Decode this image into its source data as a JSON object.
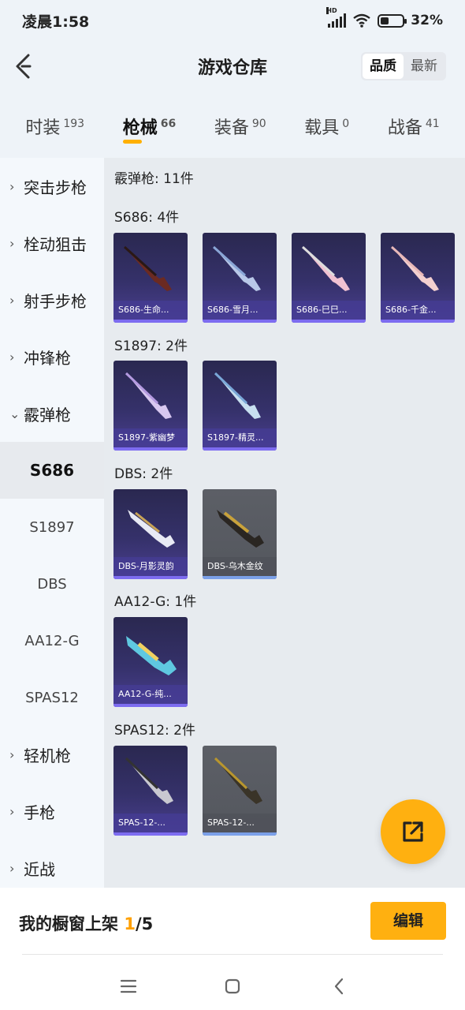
{
  "status_bar": {
    "time": "凌晨1:58",
    "network": "HD",
    "battery": "32%"
  },
  "header": {
    "title": "游戏仓库",
    "sort_options": [
      "品质",
      "最新"
    ],
    "sort_selected": 0
  },
  "tabs": [
    {
      "label": "时装",
      "count": "193"
    },
    {
      "label": "枪械",
      "count": "66"
    },
    {
      "label": "装备",
      "count": "90"
    },
    {
      "label": "载具",
      "count": "0"
    },
    {
      "label": "战备",
      "count": "41"
    }
  ],
  "sidebar": {
    "categories": {
      "assault": "突击步枪",
      "bolt": "栓动狙击",
      "marksman": "射手步枪",
      "smg": "冲锋枪",
      "shotgun": "霰弹枪",
      "lmg": "轻机枪",
      "pistol": "手枪",
      "melee": "近战"
    },
    "shotgun_sub": [
      "S686",
      "S1897",
      "DBS",
      "AA12-G",
      "SPAS12"
    ],
    "selected_sub": "S686"
  },
  "content": {
    "header": "霰弹枪: 11件",
    "groups": {
      "s686": {
        "label": "S686: 4件",
        "items": [
          "S686-生命...",
          "S686-雪月...",
          "S686-巳巳...",
          "S686-千金..."
        ]
      },
      "s1897": {
        "label": "S1897: 2件",
        "items": [
          "S1897-紫幽梦",
          "S1897-精灵..."
        ]
      },
      "dbs": {
        "label": "DBS: 2件",
        "items": [
          "DBS-月影灵韵",
          "DBS-乌木金纹"
        ]
      },
      "aa12g": {
        "label": "AA12-G: 1件",
        "items": [
          "AA12-G-纯..."
        ]
      },
      "spas12": {
        "label": "SPAS12: 2件",
        "items": [
          "SPAS-12-...",
          "SPAS-12-..."
        ]
      }
    }
  },
  "bottom": {
    "shelf_label": "我的橱窗上架",
    "shelf_current": "1",
    "shelf_total": "/5",
    "edit_label": "编辑"
  },
  "colors": {
    "accent": "#ffb010",
    "card_purple": "#35316a",
    "card_gray": "#56595f"
  },
  "icons": {
    "back": "chevron-left-icon",
    "fab": "share-external-icon",
    "nav_menu": "menu-icon",
    "nav_home": "square-home-icon",
    "nav_back": "back-icon"
  }
}
